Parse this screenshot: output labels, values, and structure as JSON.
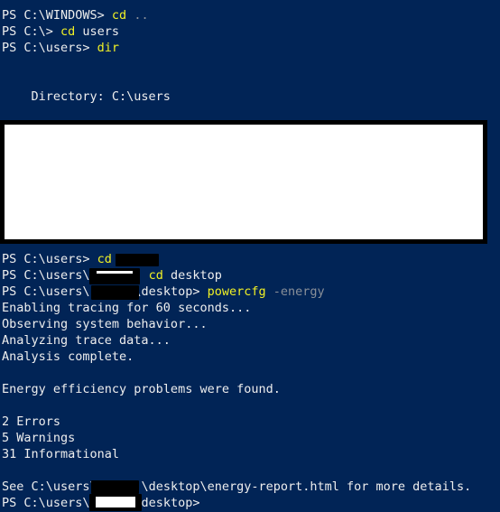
{
  "terminal": {
    "app": "Windows PowerShell",
    "background_color": "#012456",
    "text_color": "#eeeeee",
    "command_color": "#f1f125",
    "parameter_color": "#8a9099",
    "redaction_color": "#000000",
    "redaction_fill_color": "#ffffff"
  },
  "lines": {
    "l1_prompt": "PS C:\\WINDOWS> ",
    "l1_cmd": "cd",
    "l1_args": " ..",
    "l2_prompt": "PS C:\\> ",
    "l2_cmd": "cd",
    "l2_args": " users",
    "l3_prompt": "PS C:\\users> ",
    "l3_cmd": "dir",
    "l4_directory": "    Directory: C:\\users",
    "l5_prompt": "PS C:\\users> ",
    "l5_cmd": "cd",
    "l6_prompt_pre": "PS C:\\users\\",
    "l6_cmd": "cd",
    "l6_args": " desktop",
    "l7_prompt_pre": "PS C:\\users\\",
    "l7_prompt_post": "\\desktop> ",
    "l7_cmd": "powercfg",
    "l7_param": " -energy",
    "l8": "Enabling tracing for 60 seconds...",
    "l9": "Observing system behavior...",
    "l10": "Analyzing trace data...",
    "l11": "Analysis complete.",
    "l12": "Energy efficiency problems were found.",
    "l13": "2 Errors",
    "l14": "5 Warnings",
    "l15": "31 Informational",
    "l16_pre": "See C:\\users\\",
    "l16_post": "\\desktop\\energy-report.html for more details.",
    "l17_pre": "PS C:\\users\\",
    "l17_post": "\\desktop>"
  },
  "redactions": {
    "big_block_label": "redacted-directory-listing",
    "bar_1_label": "redacted-username",
    "bar_2_label": "redacted-username",
    "bar_3_label": "redacted-username",
    "bar_4_label": "redacted-username",
    "bar_5_label": "redacted-username"
  }
}
